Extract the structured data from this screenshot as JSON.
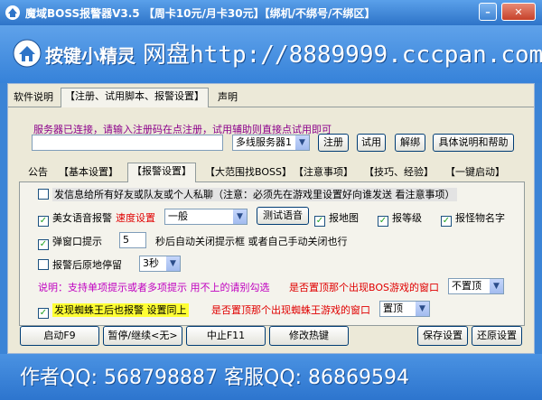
{
  "window": {
    "title": "魔域BOSS报警器V3.5 【周卡10元/月卡30元】【绑机/不绑号/不绑区】",
    "minimize_label": "–",
    "close_label": "✕"
  },
  "banner": {
    "logo_text": "按键小精灵",
    "ad_text": "网盘http://8889999.cccpan.com"
  },
  "main_tabs": [
    {
      "label": "软件说明"
    },
    {
      "label": "【注册、试用脚本、报警设置】"
    },
    {
      "label": "声明"
    }
  ],
  "register": {
    "hint": "服务器已连接，请输入注册码在点注册，试用辅助则直接点试用即可",
    "code_value": "",
    "server_select": "多线服务器1",
    "buttons": {
      "register": "注册",
      "trial": "试用",
      "unbind": "解绑",
      "help": "具体说明和帮助"
    }
  },
  "sub_tabs": [
    {
      "label": "公告"
    },
    {
      "label": "【基本设置】"
    },
    {
      "label": "【报警设置】"
    },
    {
      "label": "【大范围找BOSS】"
    },
    {
      "label": "【注意事项】"
    },
    {
      "label": "【技巧、经验】"
    },
    {
      "label": "【一键启动】"
    }
  ],
  "alarm": {
    "friend_msg": "发信息给所有好友或队友或个人私聊（注意：必须先在游戏里设置好向谁发送 看注意事项）",
    "voice_label": "美女语音报警",
    "speed_label": "速度设置",
    "speed_value": "一般",
    "test_voice": "测试语音",
    "report_map": "报地图",
    "report_level": "报等级",
    "report_name": "报怪物名字",
    "popup_label": "弹窗口提示",
    "popup_seconds": "5",
    "popup_suffix": "秒后自动关闭提示框 或者自己手动关闭也行",
    "stay_label": "报警后原地停留",
    "stay_value": "3秒",
    "note": "说明：支持单项提示或者多项提示  用不上的请别勾选",
    "top_question": "是否置顶那个出现BOS游戏的窗口",
    "top_value": "不置顶",
    "spider_label": "发现蜘蛛王后也报警 设置同上",
    "spider_question": "是否置顶那个出现蜘蛛王游戏的窗口",
    "spider_top_value": "置顶"
  },
  "bottom_buttons": {
    "start": "启动F9",
    "pause": "暂停/继续<无>",
    "stop": "中止F11",
    "hotkey": "修改热键",
    "save": "保存设置",
    "restore": "还原设置"
  },
  "footer": {
    "text": "作者QQ: 568798887  客服QQ: 86869594"
  }
}
